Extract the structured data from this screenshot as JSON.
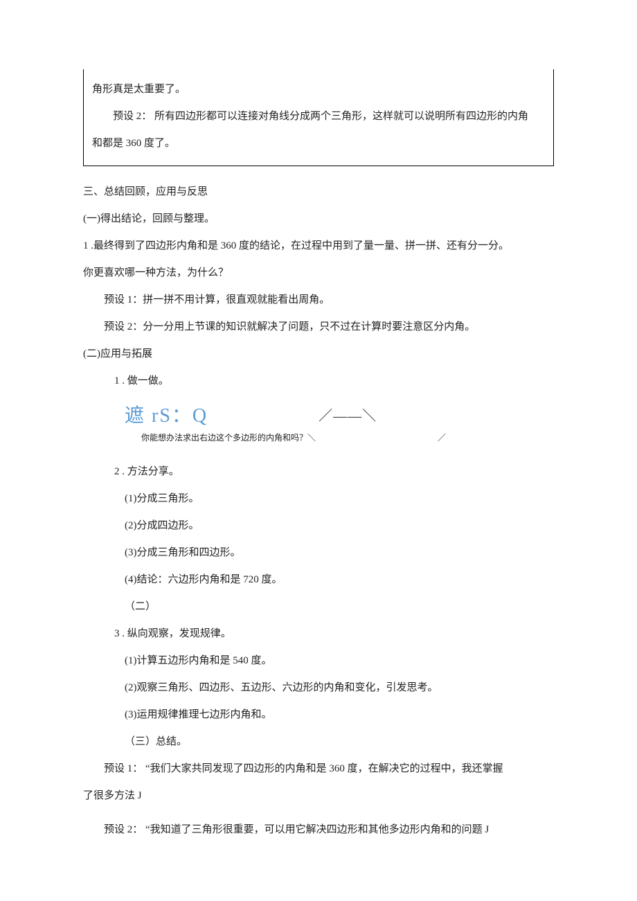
{
  "box": {
    "l1": "角形真是太重要了。",
    "l2": "预设 2： 所有四边形都可以连接对角线分成两个三角形，这样就可以说明所有四边形的内角",
    "l3": "和都是 360 度了。"
  },
  "s3": {
    "title": "三、总结回顾，应用与反思",
    "p1_title": "(一)得出结论，回顾与整理。",
    "q1a": "1 .最终得到了四边形内角和是 360 度的结论，在过程中用到了量一量、拼一拼、还有分一分。",
    "q1b": "你更喜欢哪一种方法，为什么？",
    "pre1": "预设 1：拼一拼不用计算，很直观就能看出周角。",
    "pre2": "预设 2：分一分用上节课的知识就解决了问题，只不过在计算时要注意区分内角。",
    "p2_title": "(二)应用与拓展",
    "i1": "1 . 做一做。",
    "graphic_left": "遮 rS：Q",
    "graphic_right": "／——＼",
    "caption": "你能想办法求出右边这个多边形的内角和吗？＼",
    "caption_r": "／",
    "i2": "2 . 方法分享。",
    "i2_1": "(1)分成三角形。",
    "i2_2": "(2)分成四边形。",
    "i2_3": "(3)分成三角形和四边形。",
    "i2_4": "(4)结论：六边形内角和是 720 度。",
    "i2_5": "（二）",
    "i3": "3 . 纵向观察，发现规律。",
    "i3_1": "(1)计算五边形内角和是 540 度。",
    "i3_2": "(2)观察三角形、四边形、五边形、六边形的内角和变化，引发思考。",
    "i3_3": "(3)运用规律推理七边形内角和。",
    "i3_4": "（三）总结。",
    "pre3a": "预设 1： “我们大家共同发现了四边形的内角和是 360 度，在解决它的过程中，我还掌握",
    "pre3b": "了很多方法 J",
    "pre4": "预设 2： “我知道了三角形很重要，可以用它解决四边形和其他多边形内角和的问题 J"
  }
}
